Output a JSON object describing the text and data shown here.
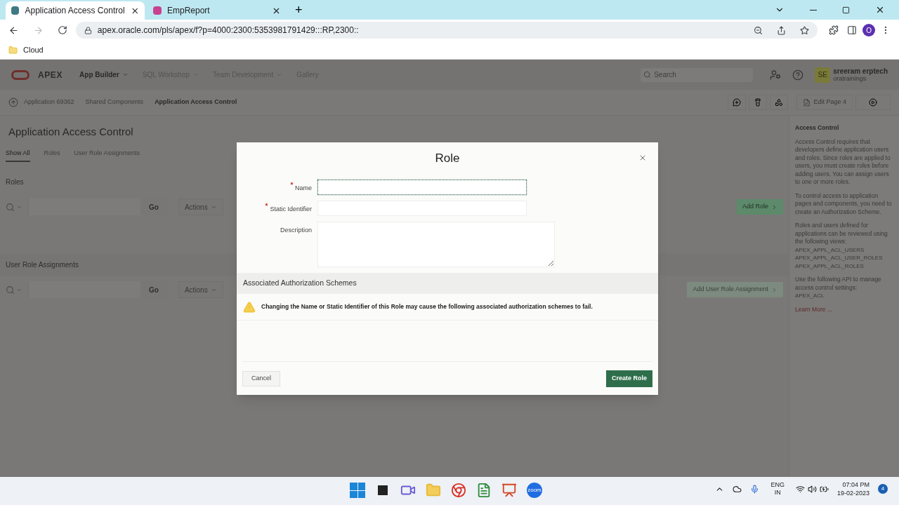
{
  "browser": {
    "tabs": [
      {
        "title": "Application Access Control",
        "selected": true
      },
      {
        "title": "EmpReport",
        "selected": false
      }
    ],
    "new_tab": "+",
    "address": "apex.oracle.com/pls/apex/f?p=4000:2300:5353981791429:::RP,2300::",
    "profile": "O",
    "bookmarks": [
      "Cloud"
    ]
  },
  "apex_header": {
    "logo": "APEX",
    "nav": [
      {
        "label": "App Builder",
        "selected": true
      },
      {
        "label": "SQL Workshop",
        "selected": false
      },
      {
        "label": "Team Development",
        "selected": false
      },
      {
        "label": "Gallery",
        "selected": false
      }
    ],
    "search_placeholder": "Search",
    "user": {
      "initials": "SE",
      "name": "sreeram erptech",
      "workspace": "oratrainings"
    }
  },
  "breadcrumbs": [
    {
      "label": "Application 69362",
      "current": false
    },
    {
      "label": "Shared Components",
      "current": false
    },
    {
      "label": "Application Access Control",
      "current": true
    }
  ],
  "edit_page": "Edit Page 4",
  "page": {
    "title": "Application Access Control",
    "tabs": [
      {
        "label": "Show All",
        "selected": true
      },
      {
        "label": "Roles",
        "selected": false
      },
      {
        "label": "User Role Assignments",
        "selected": false
      }
    ],
    "regions": [
      {
        "title": "Roles",
        "go": "Go",
        "actions": "Actions",
        "add": "Add Role"
      },
      {
        "title": "User Role Assignments",
        "go": "Go",
        "actions": "Actions",
        "add": "Add User Role Assignment"
      }
    ]
  },
  "help": {
    "title": "Access Control",
    "paragraphs": [
      {
        "text": "Access Control requires that developers define application users and roles. Since roles are applied to users, you must create roles before adding users. You can assign users to one or more roles."
      },
      {
        "text": "To control access to application pages and components, you need to create an Authorization Scheme."
      },
      {
        "text": "Roles and users defined for applications can be reviewed using the following views:",
        "code": [
          "APEX_APPL_ACL_USERS",
          "APEX_APPL_ACL_USER_ROLES",
          "APEX_APPL_ACL_ROLES"
        ]
      },
      {
        "text": "Use the following API to manage access control settings:",
        "code": [
          "APEX_ACL"
        ]
      }
    ],
    "link": "Learn More ..."
  },
  "dialog": {
    "title": "Role",
    "fields": [
      {
        "label": "Name",
        "required": true,
        "kind": "input",
        "focused": true
      },
      {
        "label": "Static Identifier",
        "required": true,
        "kind": "input",
        "focused": false
      },
      {
        "label": "Description",
        "required": false,
        "kind": "textarea",
        "focused": false
      }
    ],
    "section": "Associated Authorization Schemes",
    "warning": "Changing the Name or Static Identifier of this Role may cause the following associated authorization schemes to fail.",
    "cancel": "Cancel",
    "create": "Create Role"
  },
  "taskbar": {
    "zoom_label": "zoom",
    "language": [
      "ENG",
      "IN"
    ],
    "time": "07:04 PM",
    "date": "19-02-2023",
    "notifications": "4"
  }
}
